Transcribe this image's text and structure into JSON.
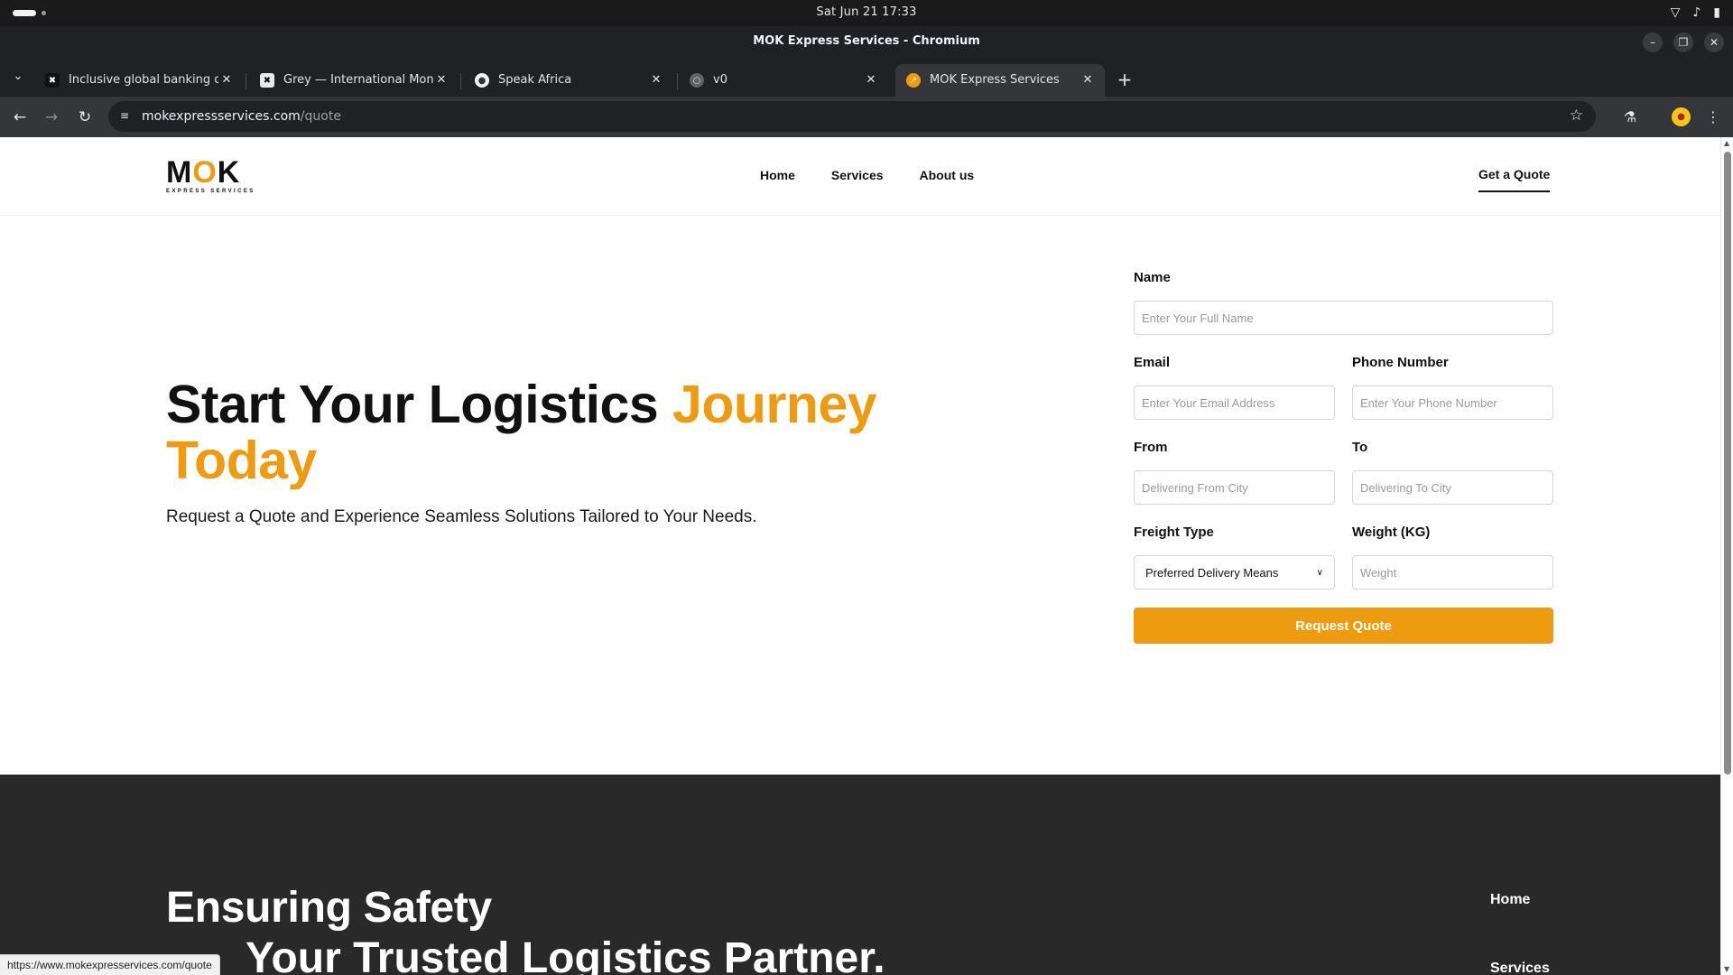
{
  "os": {
    "clock": "Sat Jun 21  17:33"
  },
  "window": {
    "title": "MOK Express Services - Chromium"
  },
  "tabs": [
    {
      "label": "Inclusive global banking desi",
      "icon": "dark-logo-icon"
    },
    {
      "label": "Grey — International Money",
      "icon": "grey-logo-icon"
    },
    {
      "label": "Speak Africa",
      "icon": "globe-icon"
    },
    {
      "label": "v0",
      "icon": "globe-icon"
    },
    {
      "label": "MOK Express Services",
      "icon": "mok-logo-icon",
      "active": true
    }
  ],
  "omnibox": {
    "domain": "mokexpressservices.com",
    "path": "/quote"
  },
  "site": {
    "logo_word_m": "M",
    "logo_word_o": "O",
    "logo_word_k": "K",
    "logo_tagline": "EXPRESS SERVICES",
    "nav": {
      "home": "Home",
      "services": "Services",
      "about": "About us"
    },
    "cta": "Get a Quote"
  },
  "hero": {
    "title_main": "Start Your Logistics ",
    "title_accent": "Journey Today",
    "subtitle": "Request a Quote and Experience Seamless Solutions Tailored to Your Needs."
  },
  "form": {
    "name_label": "Name",
    "name_placeholder": "Enter Your Full Name",
    "email_label": "Email",
    "email_placeholder": "Enter Your Email Address",
    "phone_label": "Phone Number",
    "phone_placeholder": "Enter Your Phone Number",
    "from_label": "From",
    "from_placeholder": "Delivering From City",
    "to_label": "To",
    "to_placeholder": "Delivering To City",
    "freight_label": "Freight Type",
    "freight_selected": "Preferred Delivery Means",
    "weight_label": "Weight (KG)",
    "weight_placeholder": "Weight",
    "submit": "Request Quote"
  },
  "footer": {
    "title": "Ensuring Safety",
    "subtitle": "Your Trusted Logistics Partner.",
    "links": [
      "Home",
      "Services"
    ]
  },
  "status_url": "https://www.mokexpresservices.com/quote",
  "colors": {
    "accent": "#ef9b0f",
    "footer_bg": "#292929"
  }
}
